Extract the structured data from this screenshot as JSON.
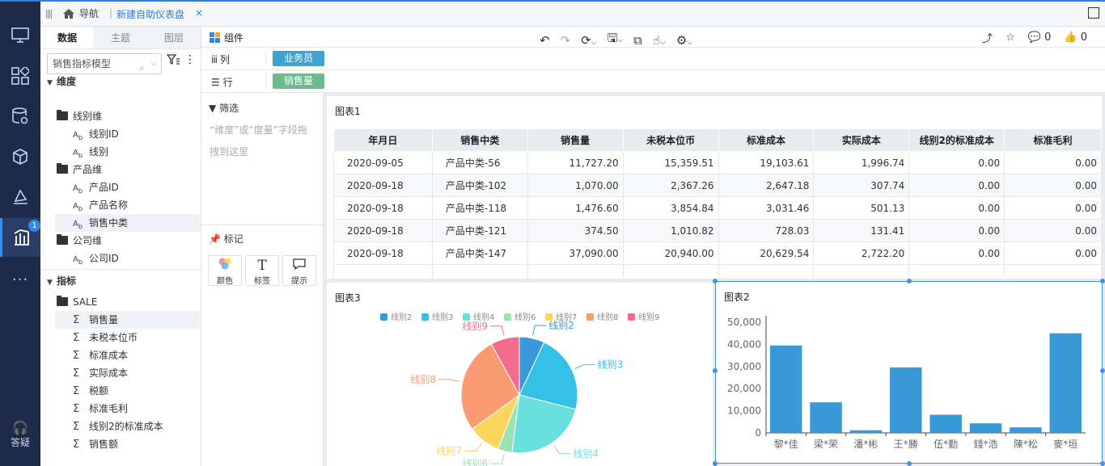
{
  "nav": {
    "home_label": "导航",
    "tab_title": "新建自助仪表盘",
    "close": "×"
  },
  "rail": {
    "badge": "1",
    "help_label": "答疑"
  },
  "left": {
    "tabs": [
      "数据",
      "主题",
      "图层"
    ],
    "model_search": "销售指标模型",
    "dim_header": "维度",
    "measure_header": "指标",
    "tree": [
      {
        "type": "folder",
        "label": "线别维"
      },
      {
        "type": "dim",
        "label": "线别ID"
      },
      {
        "type": "dim",
        "label": "线别"
      },
      {
        "type": "folder",
        "label": "产品维"
      },
      {
        "type": "dim",
        "label": "产品ID"
      },
      {
        "type": "dim",
        "label": "产品名称"
      },
      {
        "type": "dim",
        "label": "销售中类",
        "selected": true
      },
      {
        "type": "folder",
        "label": "公司维"
      },
      {
        "type": "dim",
        "label": "公司ID"
      }
    ],
    "measure_folder": "SALE",
    "measures": [
      "销售量",
      "未税本位币",
      "标准成本",
      "实际成本",
      "税额",
      "标准毛利",
      "线别2的标准成本",
      "销售额"
    ]
  },
  "toolbar": {
    "components": "组件",
    "comments": "0",
    "likes": "0"
  },
  "shelves": {
    "col_label": "列",
    "col_pill": "业务员",
    "row_label": "行",
    "row_pill": "销售量",
    "col_color": "#3ea3cf",
    "row_color": "#6cba8f"
  },
  "filter": {
    "title": "筛选",
    "hint": "“维度”或“度量”字段拖拽到这里"
  },
  "marks": {
    "title": "标记",
    "buttons": [
      {
        "icon": "color",
        "label": "颜色"
      },
      {
        "icon": "T",
        "label": "标签"
      },
      {
        "icon": "tooltip",
        "label": "提示"
      }
    ]
  },
  "chart1": {
    "title": "图表1",
    "columns": [
      "年月日",
      "销售中类",
      "销售量",
      "未税本位币",
      "标准成本",
      "实际成本",
      "线别2的标准成本",
      "标准毛利"
    ],
    "rows": [
      [
        "2020-09-05",
        "产品中类-56",
        "11,727.20",
        "15,359.51",
        "19,103.61",
        "1,996.74",
        "0.00",
        "0.00"
      ],
      [
        "2020-09-18",
        "产品中类-102",
        "1,070.00",
        "2,367.26",
        "2,647.18",
        "307.74",
        "0.00",
        "0.00"
      ],
      [
        "2020-09-18",
        "产品中类-118",
        "1,476.60",
        "3,854.84",
        "3,031.46",
        "501.13",
        "0.00",
        "0.00"
      ],
      [
        "2020-09-18",
        "产品中类-121",
        "374.50",
        "1,010.82",
        "728.03",
        "131.41",
        "0.00",
        "0.00"
      ],
      [
        "2020-09-18",
        "产品中类-147",
        "37,090.00",
        "20,940.00",
        "20,629.54",
        "2,722.20",
        "0.00",
        "0.00"
      ]
    ]
  },
  "chart_data": [
    {
      "type": "pie",
      "title": "图表3",
      "legend_position": "top",
      "categories": [
        "线别2",
        "线别3",
        "线别4",
        "线别6",
        "线别7",
        "线别8",
        "线别9"
      ],
      "values": [
        7,
        22,
        23,
        4,
        9,
        27,
        8
      ],
      "colors": [
        "#3a9ad9",
        "#35c1e6",
        "#6adfe0",
        "#9be3b7",
        "#fbd55e",
        "#fb9b72",
        "#f26d8d"
      ]
    },
    {
      "type": "bar",
      "title": "图表2",
      "categories": [
        "黎*佳",
        "梁*荣",
        "潘*彬",
        "王*勝",
        "伍*勤",
        "錢*浩",
        "陳*松",
        "麥*垣"
      ],
      "values": [
        39500,
        13800,
        1200,
        29600,
        8200,
        4300,
        2500,
        45000
      ],
      "ylim": [
        0,
        50000
      ],
      "yticks": [
        "0",
        "10,000",
        "20,000",
        "30,000",
        "40,000",
        "50,000"
      ],
      "color": "#3a9ad9"
    }
  ]
}
